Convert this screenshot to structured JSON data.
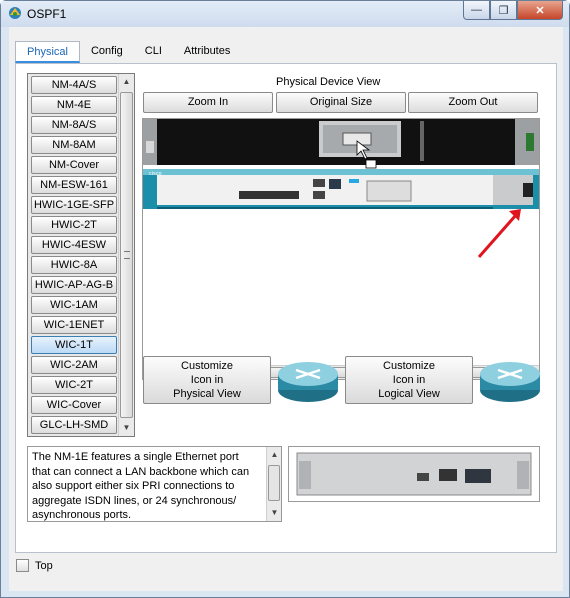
{
  "window": {
    "title": "OSPF1",
    "minimize_label": "—",
    "restore_label": "❐",
    "close_label": "✕"
  },
  "tabs": [
    {
      "label": "Physical",
      "active": true
    },
    {
      "label": "Config"
    },
    {
      "label": "CLI"
    },
    {
      "label": "Attributes"
    }
  ],
  "module_list": {
    "items": [
      "NM-4A/S",
      "NM-4E",
      "NM-8A/S",
      "NM-8AM",
      "NM-Cover",
      "NM-ESW-161",
      "HWIC-1GE-SFP",
      "HWIC-2T",
      "HWIC-4ESW",
      "HWIC-8A",
      "HWIC-AP-AG-B",
      "WIC-1AM",
      "WIC-1ENET",
      "WIC-1T",
      "WIC-2AM",
      "WIC-2T",
      "WIC-Cover",
      "GLC-LH-SMD"
    ],
    "selected": "WIC-1T"
  },
  "device_view": {
    "title": "Physical Device View",
    "zoom_in": "Zoom In",
    "original_size": "Original Size",
    "zoom_out": "Zoom Out"
  },
  "customize": {
    "physical": [
      "Customize",
      "Icon in",
      "Physical View"
    ],
    "logical": [
      "Customize",
      "Icon in",
      "Logical View"
    ]
  },
  "description": "The NM-1E features a single Ethernet port that can connect a LAN backbone which can also support either six PRI connections to aggregate ISDN lines, or 24 synchronous/ asynchronous ports.",
  "options": {
    "top_label": "Top",
    "top_checked": false
  },
  "colors": {
    "accent_blue": "#1a66b4",
    "router_teal": "#167f97",
    "annotation_red": "#e0141e"
  }
}
